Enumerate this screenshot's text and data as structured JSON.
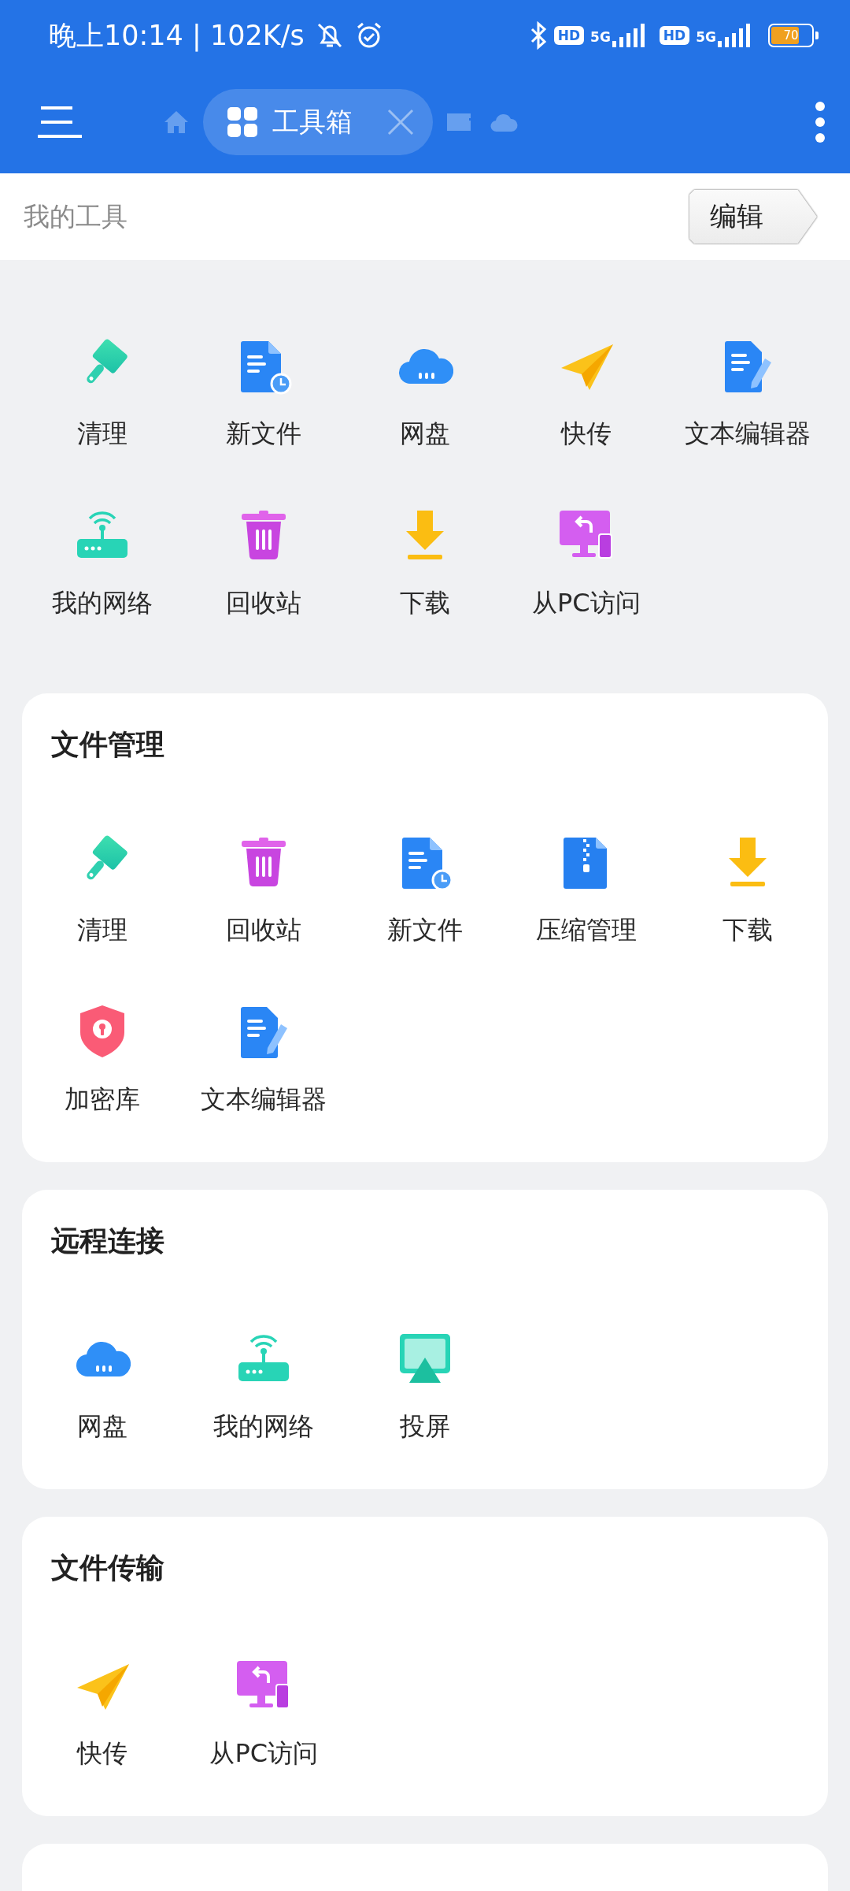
{
  "status_bar": {
    "time_speed": "晚上10:14 | 102K/s",
    "sim1_badge": "HD",
    "sim1_network": "5G",
    "sim2_badge": "HD",
    "sim2_network": "5G",
    "battery": "70"
  },
  "app_bar": {
    "tabs": [
      {
        "kind": "home",
        "selected": false
      },
      {
        "kind": "toolbox",
        "label": "工具箱",
        "selected": true
      },
      {
        "kind": "storage",
        "selected": false
      },
      {
        "kind": "cloud",
        "selected": false
      }
    ]
  },
  "my_tools": {
    "title": "我的工具",
    "edit_button": "编辑",
    "tools": [
      {
        "label": "清理",
        "kind": "brush"
      },
      {
        "label": "新文件",
        "kind": "newfile"
      },
      {
        "label": "网盘",
        "kind": "cloud"
      },
      {
        "label": "快传",
        "kind": "plane"
      },
      {
        "label": "文本编辑器",
        "kind": "editor"
      },
      {
        "label": "我的网络",
        "kind": "router"
      },
      {
        "label": "回收站",
        "kind": "trash"
      },
      {
        "label": "下载",
        "kind": "download"
      },
      {
        "label": "从PC访问",
        "kind": "pc"
      }
    ]
  },
  "sections": [
    {
      "title": "文件管理",
      "tools": [
        {
          "label": "清理",
          "kind": "brush"
        },
        {
          "label": "回收站",
          "kind": "trash"
        },
        {
          "label": "新文件",
          "kind": "newfile"
        },
        {
          "label": "压缩管理",
          "kind": "zip"
        },
        {
          "label": "下载",
          "kind": "download"
        },
        {
          "label": "加密库",
          "kind": "vault"
        },
        {
          "label": "文本编辑器",
          "kind": "editor"
        }
      ]
    },
    {
      "title": "远程连接",
      "tools": [
        {
          "label": "网盘",
          "kind": "cloud"
        },
        {
          "label": "我的网络",
          "kind": "router"
        },
        {
          "label": "投屏",
          "kind": "cast"
        }
      ]
    },
    {
      "title": "文件传输",
      "tools": [
        {
          "label": "快传",
          "kind": "plane"
        },
        {
          "label": "从PC访问",
          "kind": "pc"
        }
      ]
    }
  ]
}
